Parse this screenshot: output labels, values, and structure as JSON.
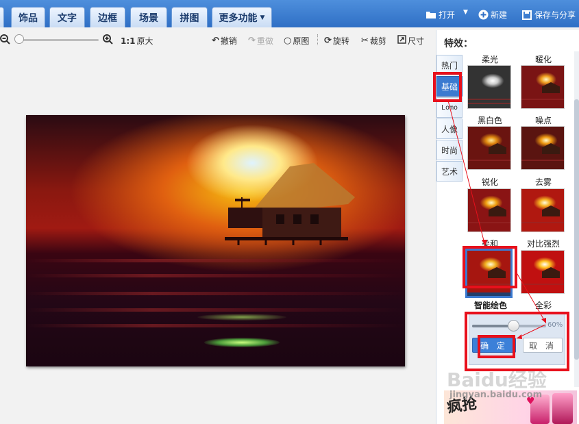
{
  "topbar": {
    "tabs": [
      "饰品",
      "文字",
      "边框",
      "场景",
      "拼图"
    ],
    "more_label": "更多功能",
    "open_label": "打开",
    "new_label": "新建",
    "save_label": "保存与分享"
  },
  "toolbar": {
    "actual_size_icon_text": "1:1",
    "actual_size_label": "原大",
    "undo_label": "撤销",
    "redo_label": "重做",
    "original_label": "原图",
    "rotate_label": "旋转",
    "crop_label": "裁剪",
    "size_label": "尺寸"
  },
  "panel": {
    "title": "特效：",
    "categories": [
      "热门",
      "基础",
      "Lomo",
      "人像",
      "时尚",
      "艺术"
    ],
    "active_category": "基础",
    "effects": [
      "柔光",
      "暖化",
      "黑白色",
      "噪点",
      "锐化",
      "去雾",
      "柔和",
      "对比强烈",
      "智能绘色",
      "全彩"
    ],
    "selected_effect": "柔和",
    "opacity_text": "60%",
    "opacity_value": 0.6,
    "confirm_label": "确 定",
    "cancel_label": "取 消"
  },
  "ad": {
    "text": "疯抢"
  },
  "watermark": {
    "main": "Baidu经验",
    "sub": "jingyan.baidu.com"
  },
  "colors": {
    "accent": "#3b7ad0",
    "highlight": "#e8101c"
  }
}
